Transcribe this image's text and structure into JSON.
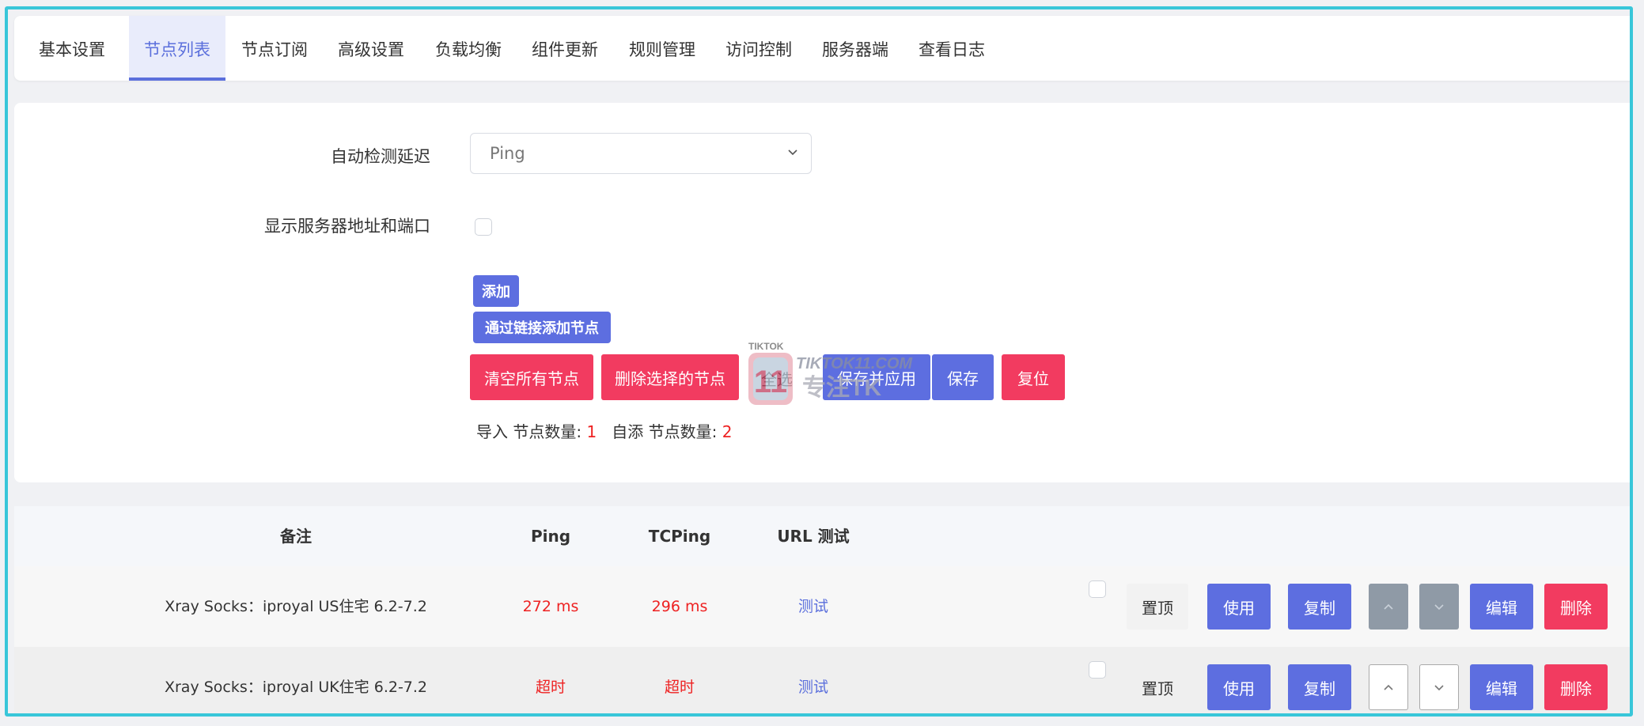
{
  "tabs": [
    {
      "label": "基本设置",
      "active": false
    },
    {
      "label": "节点列表",
      "active": true
    },
    {
      "label": "节点订阅",
      "active": false
    },
    {
      "label": "高级设置",
      "active": false
    },
    {
      "label": "负载均衡",
      "active": false
    },
    {
      "label": "组件更新",
      "active": false
    },
    {
      "label": "规则管理",
      "active": false
    },
    {
      "label": "访问控制",
      "active": false
    },
    {
      "label": "服务器端",
      "active": false
    },
    {
      "label": "查看日志",
      "active": false
    }
  ],
  "settings": {
    "auto_latency_label": "自动检测延迟",
    "auto_latency_value": "Ping",
    "show_addr_label": "显示服务器地址和端口",
    "show_addr_checked": false
  },
  "actions": {
    "add": "添加",
    "add_by_link": "通过链接添加节点",
    "clear_all": "清空所有节点",
    "delete_selected": "删除选择的节点",
    "select_all": "全选",
    "save_apply": "保存并应用",
    "save": "保存",
    "reset": "复位"
  },
  "counts": {
    "import_label": "导入 节点数量:",
    "import_value": "1",
    "custom_label": "自添 节点数量:",
    "custom_value": "2"
  },
  "watermark": {
    "brand": "TIKTOK",
    "site": "TIKTOK11.COM",
    "tagline": "专注TK"
  },
  "table": {
    "headers": {
      "remark": "备注",
      "ping": "Ping",
      "tcping": "TCPing",
      "url_test": "URL 测试"
    },
    "row_actions": {
      "top": "置顶",
      "use": "使用",
      "copy": "复制",
      "edit": "编辑",
      "delete": "删除"
    },
    "rows": [
      {
        "remark": "Xray Socks：iproyal US住宅 6.2-7.2",
        "ping": "272 ms",
        "tcping": "296 ms",
        "url_test": "测试",
        "checked": false
      },
      {
        "remark": "Xray Socks：iproyal UK住宅 6.2-7.2",
        "ping": "超时",
        "tcping": "超时",
        "url_test": "测试",
        "checked": false
      }
    ]
  },
  "colors": {
    "accent": "#5d6ee0",
    "danger": "#f23b60",
    "frame": "#38c6d9",
    "latency": "#ee2222"
  }
}
